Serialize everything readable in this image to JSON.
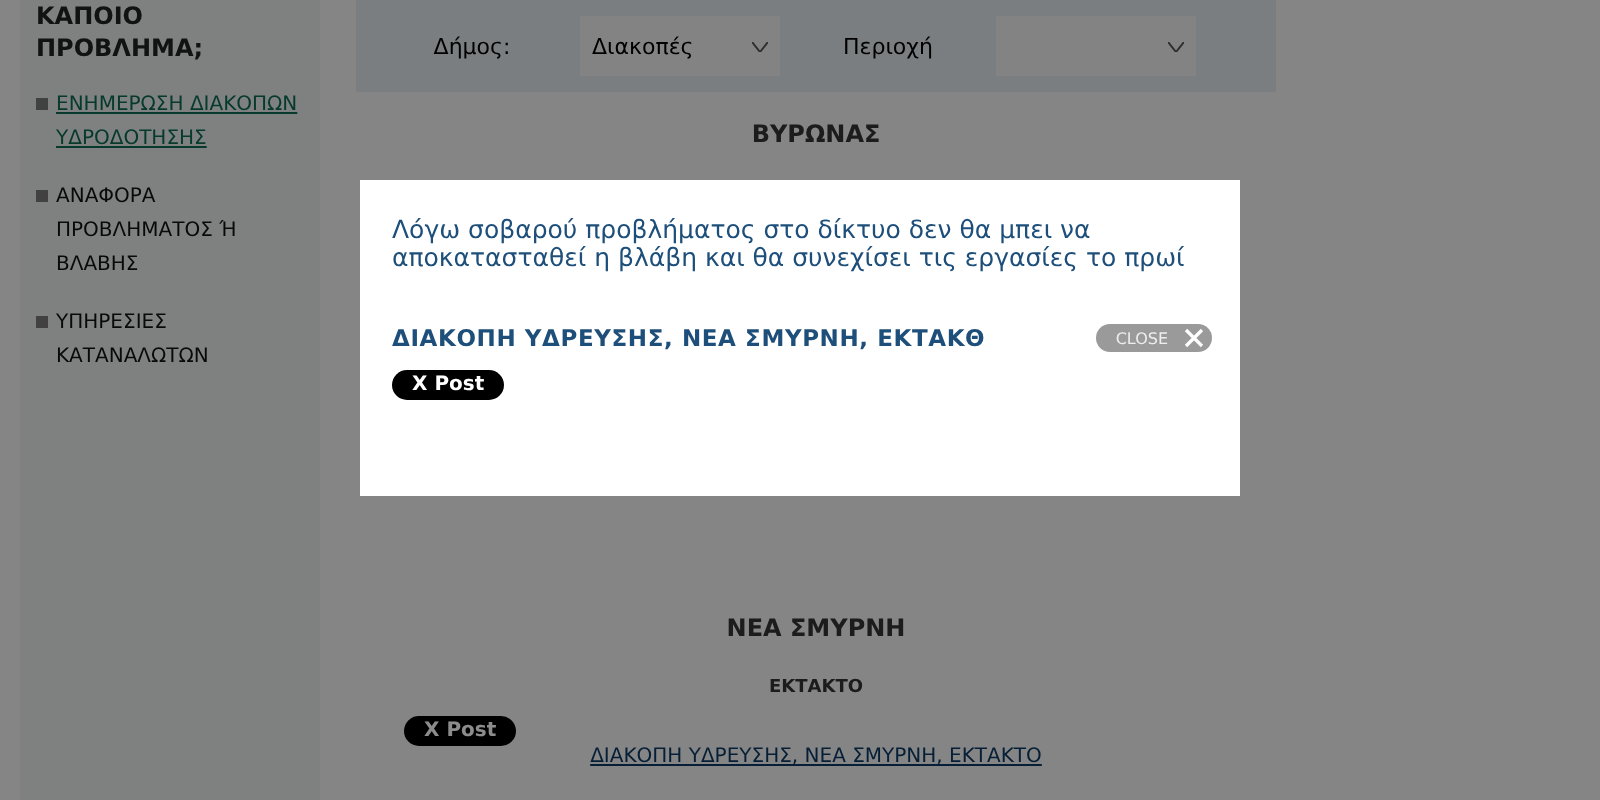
{
  "sidebar": {
    "heading": "ΚΑΠΟΙΟ ΠΡΟΒΛΗΜΑ;",
    "items": [
      {
        "label": "ΕΝΗΜΕΡΩΣΗ ΔΙΑΚΟΠΩΝ ΥΔΡΟΔΟΤΗΣΗΣ",
        "selected": true
      },
      {
        "label": "ΑΝΑΦΟΡΑ ΠΡΟΒΛΗΜΑΤΟΣ Ή ΒΛΑΒΗΣ",
        "selected": false
      },
      {
        "label": "ΥΠΗΡΕΣΙΕΣ ΚΑΤΑΝΑΛΩΤΩΝ",
        "selected": false
      }
    ]
  },
  "filters": [
    {
      "label": "Δήμος:",
      "value": "Διακοπές"
    },
    {
      "label": "Περιοχή"
    }
  ],
  "sections": [
    {
      "title": "ΒΥΡΩΝΑΣ"
    },
    {
      "title": "ΝΕΑ ΣΜΥΡΝΗ",
      "status": "ΕΚΤΑΚΤΟ",
      "post_button": "X Post",
      "link": "ΔΙΑΚΟΠΗ ΥΔΡΕΥΣΗΣ, ΝΕΑ ΣΜΥΡΝΗ, ΕΚΤΑΚΤΟ"
    }
  ],
  "modal": {
    "message": "Λόγω σοβαρού προβλήματος στο δίκτυο δεν θα μπει να αποκατασταθεί η βλάβη και θα συνεχίσει τις εργασίες το πρωί",
    "title": "ΔΙΑΚΟΠΗ ΥΔΡΕΥΣΗΣ, ΝΕΑ ΣΜΥΡΝΗ, ΕΚΤΑΚΘ",
    "post_button": "X Post",
    "close_button": "CLOSE"
  }
}
